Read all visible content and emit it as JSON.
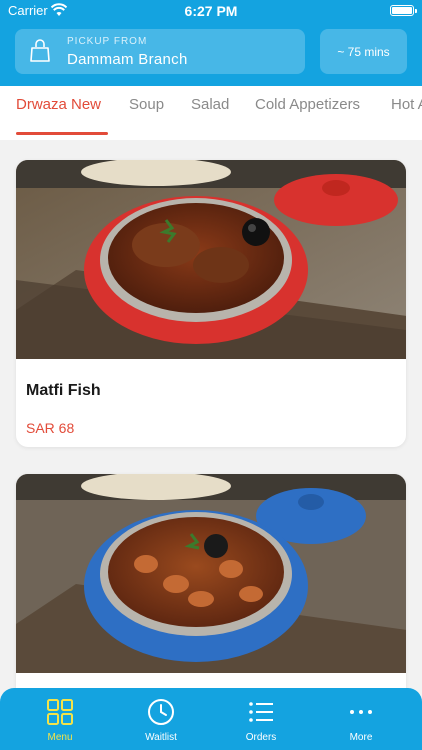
{
  "status_bar": {
    "carrier": "Carrier",
    "time": "6:27 PM"
  },
  "header": {
    "pickup_label": "PICKUP FROM",
    "branch": "Dammam Branch",
    "eta": "~ 75 mins"
  },
  "tabs": [
    {
      "label": "Drwaza New",
      "active": true
    },
    {
      "label": "Soup",
      "active": false
    },
    {
      "label": "Salad",
      "active": false
    },
    {
      "label": "Cold Appetizers",
      "active": false
    },
    {
      "label": "Hot A",
      "active": false
    }
  ],
  "items": [
    {
      "name": "Matfi Fish",
      "price": "SAR 68",
      "pot_color": "#d8322e"
    },
    {
      "name": "",
      "price": "",
      "pot_color": "#2e6fc4"
    }
  ],
  "bottom_nav": [
    {
      "label": "Menu",
      "icon": "grid-icon",
      "active": true
    },
    {
      "label": "Waitlist",
      "icon": "clock-icon",
      "active": false
    },
    {
      "label": "Orders",
      "icon": "list-icon",
      "active": false
    },
    {
      "label": "More",
      "icon": "more-dots-icon",
      "active": false
    }
  ],
  "colors": {
    "brand": "#14a3e0",
    "accent": "#e24b39",
    "active_nav": "#f2e34a"
  }
}
